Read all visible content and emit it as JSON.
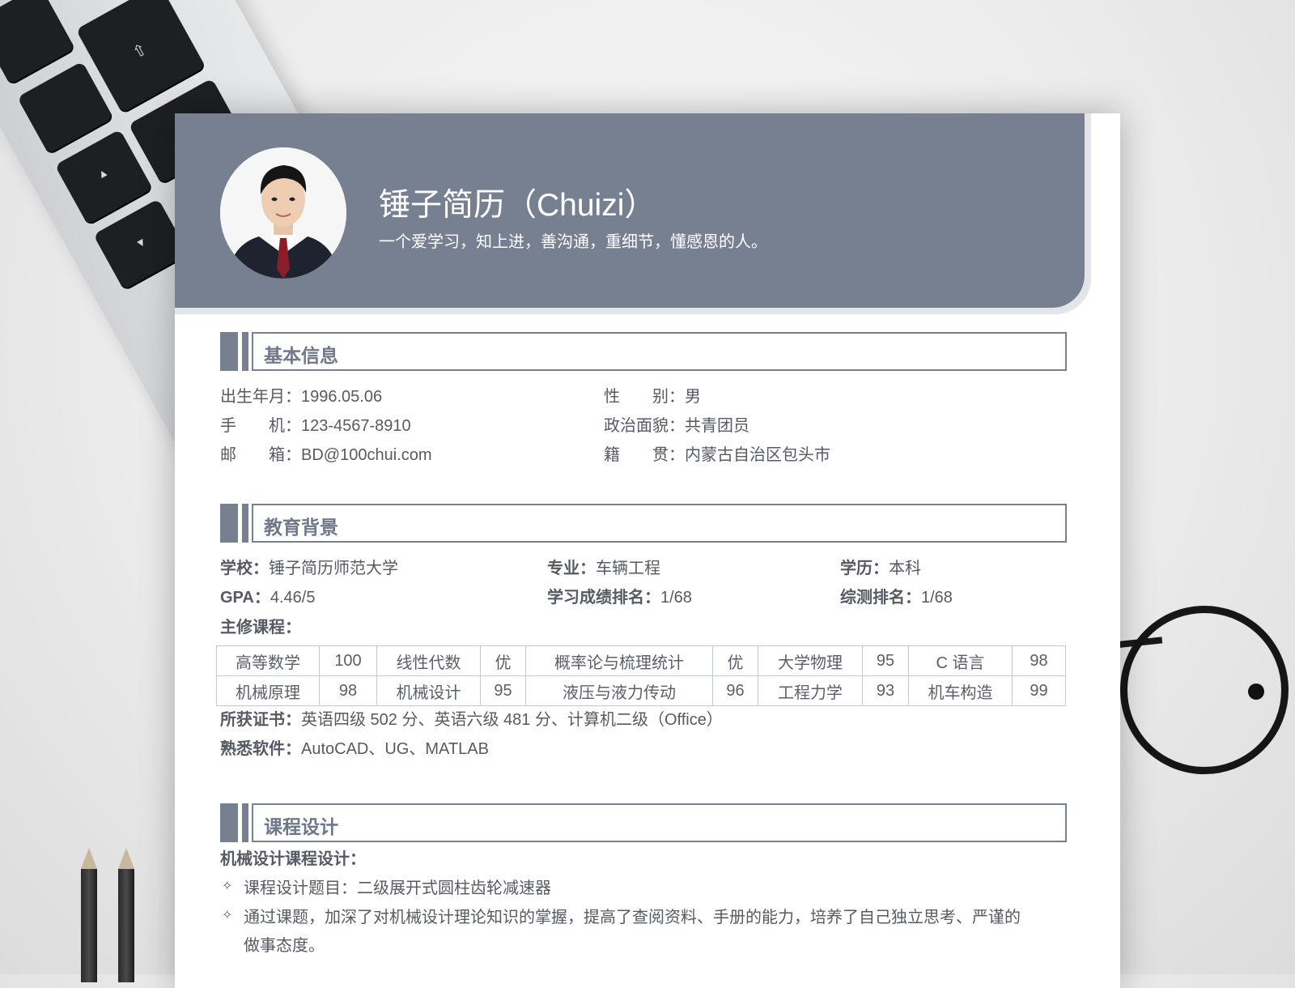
{
  "header": {
    "name": "锤子简历（Chuizi）",
    "motto": "一个爱学习，知上进，善沟通，重细节，懂感恩的人。"
  },
  "basic_info": {
    "title": "基本信息",
    "birth_label": "出生年月：",
    "birth_value": "1996.05.06",
    "phone_label": "手　　机：",
    "phone_value": "123-4567-8910",
    "email_label": "邮　　箱：",
    "email_value": "BD@100chui.com",
    "gender_label": "性　　别：",
    "gender_value": "男",
    "politics_label": "政治面貌：",
    "politics_value": "共青团员",
    "origin_label": "籍　　贯：",
    "origin_value": "内蒙古自治区包头市"
  },
  "education": {
    "title": "教育背景",
    "school_label": "学校：",
    "school_value": "锤子简历师范大学",
    "major_label": "专业：",
    "major_value": "车辆工程",
    "degree_label": "学历：",
    "degree_value": "本科",
    "gpa_label": "GPA：",
    "gpa_value": "4.46/5",
    "rank_label": "学习成绩排名：",
    "rank_value": "1/68",
    "overall_label": "综测排名：",
    "overall_value": "1/68",
    "courses_label": "主修课程：",
    "courses": [
      [
        "高等数学",
        "100",
        "线性代数",
        "优",
        "概率论与梳理统计",
        "优",
        "大学物理",
        "95",
        "C 语言",
        "98"
      ],
      [
        "机械原理",
        "98",
        "机械设计",
        "95",
        "液压与液力传动",
        "96",
        "工程力学",
        "93",
        "机车构造",
        "99"
      ]
    ],
    "cert_label": "所获证书：",
    "cert_value": "英语四级 502 分、英语六级 481 分、计算机二级（Office）",
    "software_label": "熟悉软件：",
    "software_value": "AutoCAD、UG、MATLAB"
  },
  "course_design": {
    "title": "课程设计",
    "subtitle": "机械设计课程设计：",
    "bullet_icon": "diamond-bullet-icon",
    "items": [
      "课程设计题目：二级展开式圆柱齿轮减速器",
      "通过课题，加深了对机械设计理论知识的掌握，提高了查阅资料、手册的能力，培养了自己独立思考、严谨的",
      "做事态度。"
    ]
  },
  "colors": {
    "header_bg": "#778091",
    "accent": "#778091",
    "text": "#555a63"
  }
}
